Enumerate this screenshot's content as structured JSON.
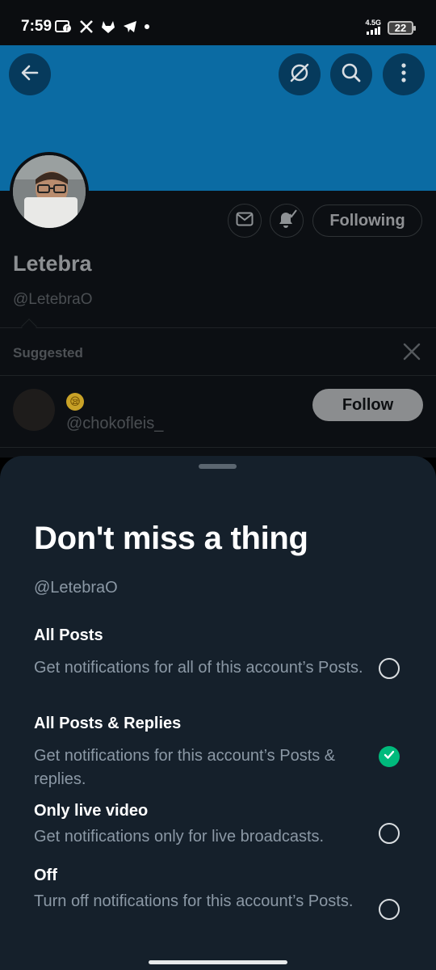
{
  "status_bar": {
    "time": "7:59",
    "network": "4.5G",
    "battery": "22",
    "icons": [
      "photo-icon",
      "x-logo-icon",
      "gitlab-icon",
      "telegram-icon",
      "dot-icon"
    ]
  },
  "header": {
    "icons": [
      "back-arrow-icon",
      "no-satellite-icon",
      "search-icon",
      "more-vertical-icon"
    ]
  },
  "profile": {
    "name": "Letebra",
    "handle": "@LetebraO",
    "following_label": "Following",
    "icons": [
      "message-icon",
      "bell-subscribed-icon"
    ]
  },
  "suggested": {
    "label": "Suggested",
    "user_emoji": "😪",
    "user_handle": "@chokofleis_",
    "follow_label": "Follow"
  },
  "sheet": {
    "title": "Don't miss a thing",
    "handle": "@LetebraO",
    "options": [
      {
        "title": "All Posts",
        "desc": "Get notifications for all of this account’s Posts.",
        "selected": false
      },
      {
        "title": "All Posts & Replies",
        "desc": "Get notifications for this account’s Posts & replies.",
        "selected": true
      },
      {
        "title": "Only live video",
        "desc": "Get notifications only for live broadcasts.",
        "selected": false
      },
      {
        "title": "Off",
        "desc": "Turn off notifications for this account’s Posts.",
        "selected": false
      }
    ]
  },
  "colors": {
    "banner": "#0b6ba3",
    "sheet_bg": "#15202b",
    "selected_green": "#00ba7c",
    "secondary_text": "#8b98a5"
  }
}
